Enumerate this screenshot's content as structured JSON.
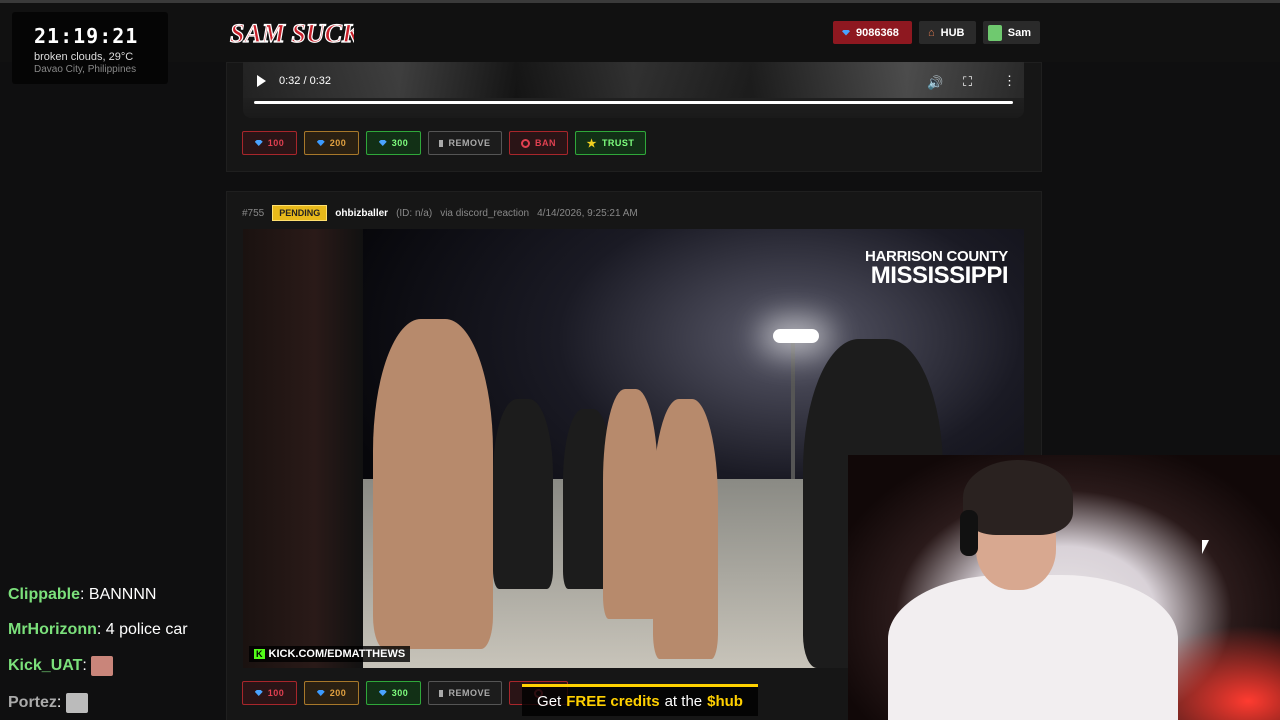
{
  "overlay": {
    "clock": "21:19:21",
    "weather": "broken clouds, 29°C",
    "location": "Davao City, Philippines"
  },
  "header": {
    "logo_text": "SAM SUCKS",
    "credits": "9086368",
    "hub_label": "HUB",
    "user_name": "Sam"
  },
  "player_top": {
    "time": "0:32 / 0:32"
  },
  "actions": {
    "c100": "100",
    "c200": "200",
    "c300": "300",
    "remove": "REMOVE",
    "ban": "BAN",
    "trust": "TRUST"
  },
  "submission": {
    "number": "#755",
    "status": "PENDING",
    "user": "ohbizballer",
    "id": "(ID: n/a)",
    "via": "via discord_reaction",
    "timestamp": "4/14/2026, 9:25:21 AM",
    "caption_line1": "HARRISON COUNTY",
    "caption_line2": "MISSISSIPPI",
    "watermark_k": "K",
    "watermark": "KICK.COM/EDMATTHEWS"
  },
  "chat": [
    {
      "name": "Clippable",
      "color": "#7be07b",
      "message": "BANNNN"
    },
    {
      "name": "MrHorizonn",
      "color": "#7be07b",
      "message": "4 police car"
    },
    {
      "name": "Kick_UAT",
      "color": "#7be07b",
      "message": ""
    },
    {
      "name": "Portez",
      "color": "#aaaaaa",
      "message": ""
    }
  ],
  "banner": {
    "part1": "Get",
    "part2": "FREE credits",
    "part3": "at the",
    "part4": "$hub"
  },
  "colors": {
    "accent_red": "#8e1820",
    "pending_yellow": "#e8b91a",
    "kick_green": "#53fc18"
  }
}
